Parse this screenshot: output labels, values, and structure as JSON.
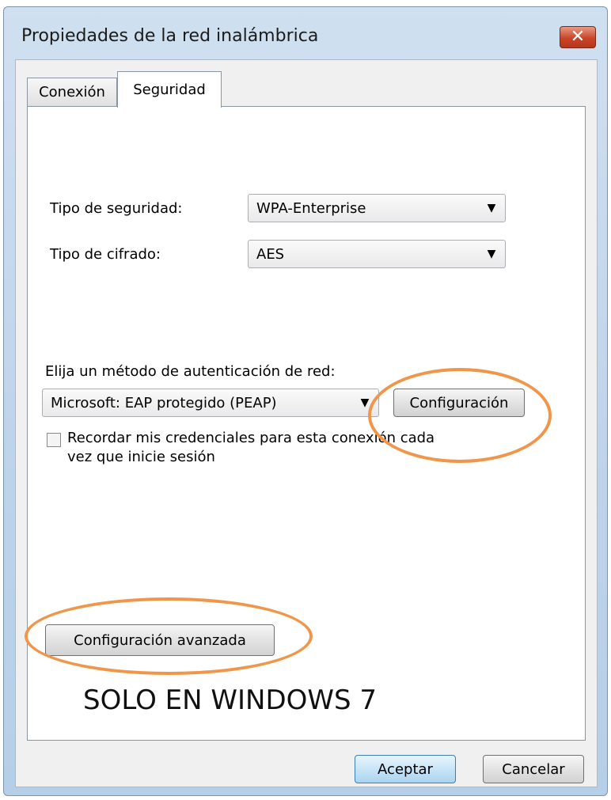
{
  "window": {
    "title": "Propiedades de la red inalámbrica",
    "close_glyph": "✕"
  },
  "tabs": [
    {
      "label": "Conexión"
    },
    {
      "label": "Seguridad"
    }
  ],
  "security": {
    "type_label": "Tipo de seguridad:",
    "type_value": "WPA-Enterprise",
    "cipher_label": "Tipo de cifrado:",
    "cipher_value": "AES",
    "auth_label": "Elija un método de autenticación de red:",
    "auth_value": "Microsoft: EAP protegido (PEAP)",
    "settings_button": "Configuración",
    "remember_line1": "Recordar mis credenciales para esta conexión cada",
    "remember_line2": "vez que inicie sesión",
    "remember_checked": false,
    "advanced_button": "Configuración avanzada"
  },
  "annotation": {
    "text": "SOLO EN WINDOWS 7",
    "color": "#f0964a"
  },
  "footer": {
    "ok": "Aceptar",
    "cancel": "Cancelar"
  },
  "icons": {
    "dropdown": "▼"
  }
}
